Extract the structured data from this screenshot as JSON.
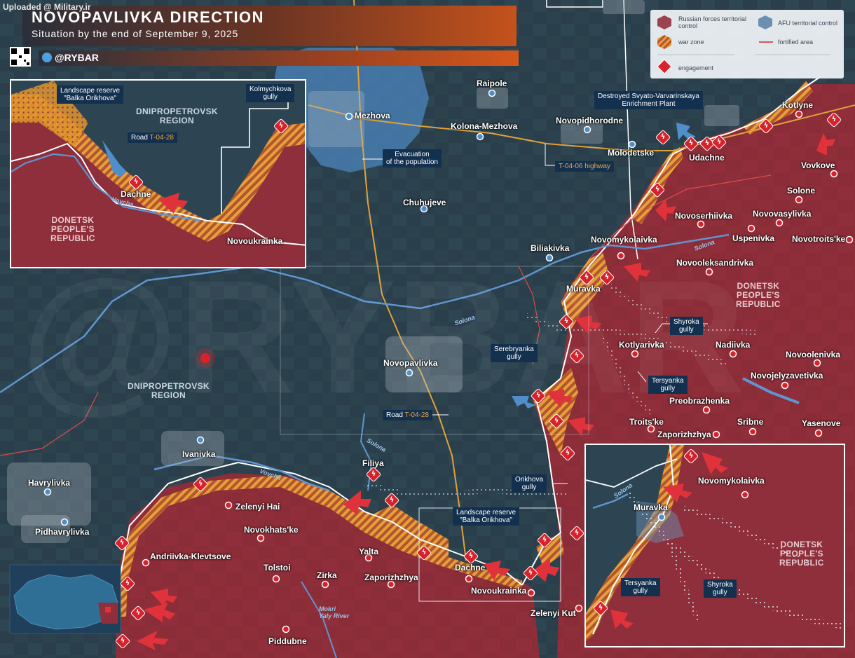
{
  "watermark": "Uploaded @ Military.ir",
  "header": {
    "title": "NOVOPAVLIVKA DIRECTION",
    "subtitle": "Situation by the end of September 9, 2025",
    "brand": "@RYBAR"
  },
  "legend": {
    "russian": "Russian forces territorial control",
    "afu": "AFU territorial control",
    "war_zone": "war zone",
    "fortified": "fortified area",
    "engagement": "engagement"
  },
  "colors": {
    "russian": "#8e2f3b",
    "afu": "#4f8ec9",
    "war_zone": "#e0962d",
    "engagement": "#d8222b",
    "background": "#24394a"
  },
  "settlements": [
    {
      "id": "mezhova",
      "name": "Mezhova"
    },
    {
      "id": "raipole",
      "name": "Raipole"
    },
    {
      "id": "kolona",
      "name": "Kolona-Mezhova"
    },
    {
      "id": "novopidhorodne",
      "name": "Novopidhorodne"
    },
    {
      "id": "molodetske",
      "name": "Molodetske"
    },
    {
      "id": "udachne",
      "name": "Udachne"
    },
    {
      "id": "kotlyne",
      "name": "Kotlyne"
    },
    {
      "id": "vovkove",
      "name": "Vovkove"
    },
    {
      "id": "solone",
      "name": "Solone"
    },
    {
      "id": "novoserhiivka",
      "name": "Novoserhiivka"
    },
    {
      "id": "novovasylivka",
      "name": "Novovasylivka"
    },
    {
      "id": "uspenivka",
      "name": "Uspenivka"
    },
    {
      "id": "novotroitske",
      "name": "Novotroits'ke"
    },
    {
      "id": "chuhujeve",
      "name": "Chuhujeve"
    },
    {
      "id": "biliakivka",
      "name": "Biliakivka"
    },
    {
      "id": "novomykolaivka",
      "name": "Novomykolaivka"
    },
    {
      "id": "novooleksandrivka",
      "name": "Novooleksandrivka"
    },
    {
      "id": "muravka",
      "name": "Muravka"
    },
    {
      "id": "kotlyarivka",
      "name": "Kotlyarivka"
    },
    {
      "id": "nadiivka",
      "name": "Nadiivka"
    },
    {
      "id": "novoolenivka",
      "name": "Novoolenivka"
    },
    {
      "id": "novojelyzavetivka",
      "name": "Novojelyzavetivka"
    },
    {
      "id": "novopavlivka",
      "name": "Novopavlivka"
    },
    {
      "id": "preobrazhenka",
      "name": "Preobrazhenka"
    },
    {
      "id": "troitske",
      "name": "Troits'ke"
    },
    {
      "id": "sribne",
      "name": "Sribne"
    },
    {
      "id": "yasenove",
      "name": "Yasenove"
    },
    {
      "id": "zaporizhzhya_e",
      "name": "Zaporizhzhya"
    },
    {
      "id": "ivanivka",
      "name": "Ivanivka"
    },
    {
      "id": "havrylivka",
      "name": "Havrylivka"
    },
    {
      "id": "pidhavrylivka",
      "name": "Pidhavrylivka"
    },
    {
      "id": "filiya",
      "name": "Filiya"
    },
    {
      "id": "zelenyi_hai",
      "name": "Zelenyi Hai"
    },
    {
      "id": "novokhatske",
      "name": "Novokhats'ke"
    },
    {
      "id": "andriivka",
      "name": "Andriivka-Klevtsove"
    },
    {
      "id": "tolstoi",
      "name": "Tolstoi"
    },
    {
      "id": "zirka",
      "name": "Zirka"
    },
    {
      "id": "yalta",
      "name": "Yalta"
    },
    {
      "id": "zaporizhzhya_s",
      "name": "Zaporizhzhya"
    },
    {
      "id": "dachne",
      "name": "Dachne"
    },
    {
      "id": "novoukrainka",
      "name": "Novoukrainka"
    },
    {
      "id": "zelenyi_kut",
      "name": "Zelenyi Kut"
    },
    {
      "id": "piddubne",
      "name": "Piddubne"
    }
  ],
  "regions": {
    "dnipro_main": "DNIPROPETROVSK\nREGION",
    "donetsk_main": "DONETSK\nPEOPLE'S\nREPUBLIC"
  },
  "rivers": {
    "solona_main": "Solona",
    "solona_west": "Solona",
    "vovcha": "Vovcha",
    "mokri_yaly": "Mokri\nYaly River",
    "solona_sw": "Solona"
  },
  "callouts": {
    "evacuation": "Evacuation\nof the population",
    "highway": "T-04-06 highway",
    "enrichment": "Destroyed Svyato-Varvarinskaya\nEnrichment Plant",
    "shyroka": "Shyroka\ngully",
    "serebryanka": "Serebryanka\ngully",
    "tersyanka": "Tersyanka\ngully",
    "road_prefix": "Road ",
    "road_code": "T-04-28",
    "orikhova": "Orikhova\ngully",
    "landscape": "Landscape reserve\n\"Balka Orikhova\""
  },
  "inset_west": {
    "landscape": "Landscape reserve\n\"Balka Orikhova\"",
    "kolmychkova": "Kolmychkova\ngully",
    "dnipro": "DNIPROPETROVSK\nREGION",
    "road_prefix": "Road ",
    "road_code": "T-04-28",
    "dachne": "Dachne",
    "donetsk": "DONETSK\nPEOPLE'S\nREPUBLIC",
    "novoukrainka": "Novoukrainka",
    "river": "Vovcha"
  },
  "inset_east": {
    "novomykolaivka": "Novomykolaivka",
    "muravka": "Muravka",
    "donetsk": "DONETSK\nPEOPLE'S\nREPUBLIC",
    "tersyanka": "Tersyanka\ngully",
    "shyroka": "Shyroka\ngully",
    "river": "Solona"
  }
}
